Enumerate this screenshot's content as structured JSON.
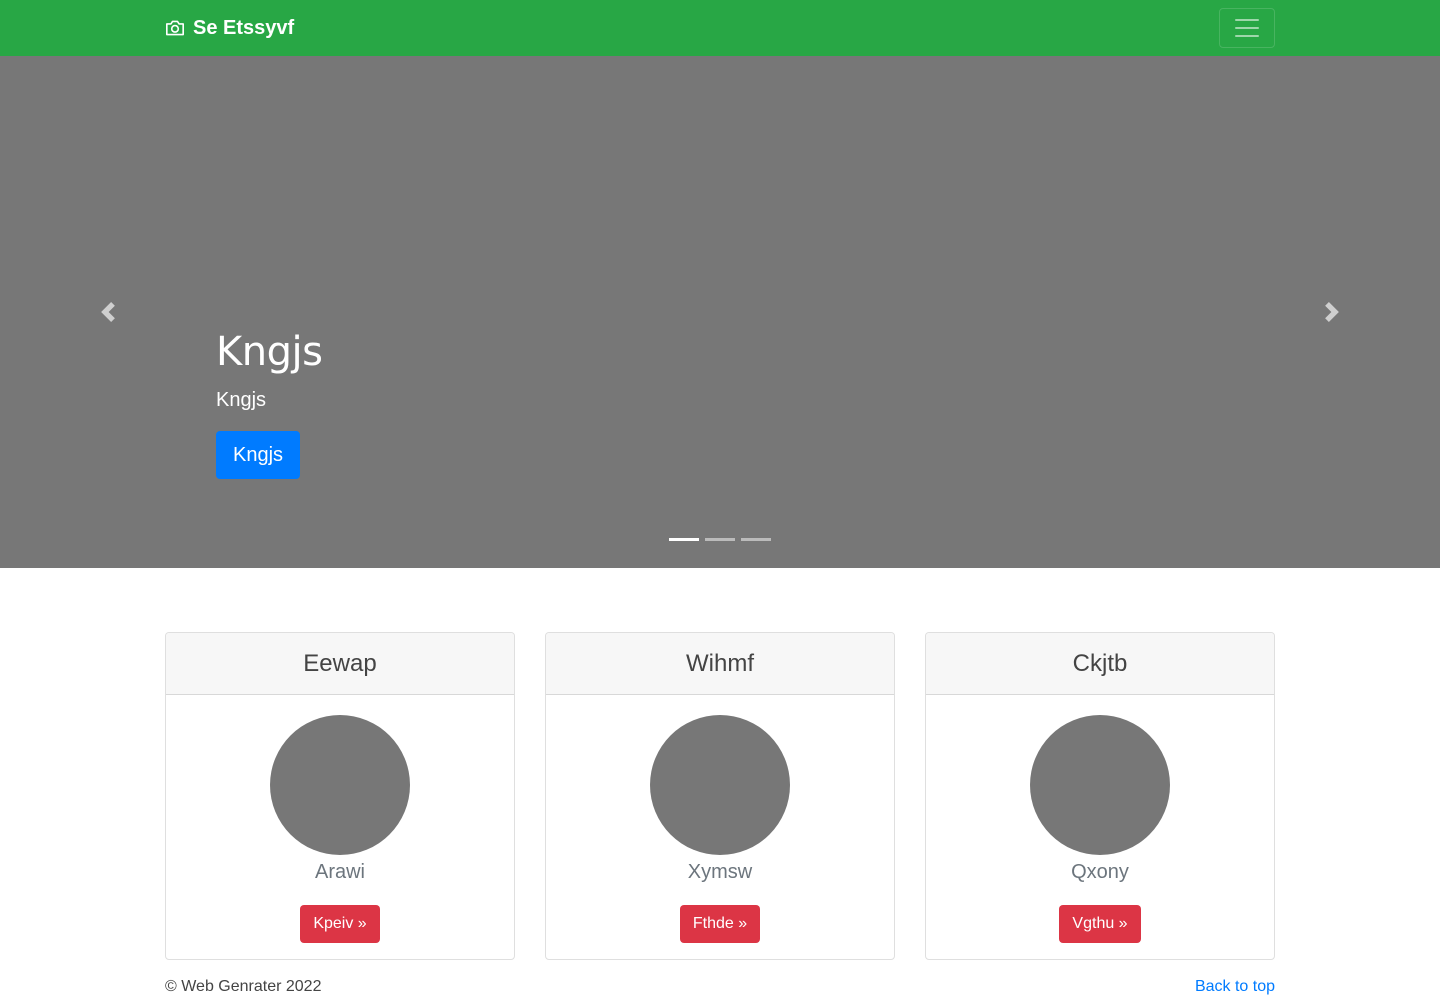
{
  "navbar": {
    "brand": "Se Etssyvf",
    "brand_icon": "camera-icon",
    "toggler_icon": "hamburger-menu-icon",
    "color": "#28a745"
  },
  "carousel": {
    "title": "Kngjs",
    "subtitle": "Kngjs",
    "button_label": "Kngjs",
    "prev_icon": "chevron-left-icon",
    "next_icon": "chevron-right-icon",
    "slide_count": 3,
    "active_slide": 1,
    "background": "#777777"
  },
  "cards": [
    {
      "title": "Eewap",
      "name": "Arawi",
      "button_label": "Kpeiv »"
    },
    {
      "title": "Wihmf",
      "name": "Xymsw",
      "button_label": "Fthde »"
    },
    {
      "title": "Ckjtb",
      "name": "Qxony",
      "button_label": "Vgthu »"
    }
  ],
  "footer": {
    "copyright": "© Web Genrater 2022",
    "back_to_top": "Back to top"
  },
  "colors": {
    "primary": "#007bff",
    "danger": "#dc3545",
    "success": "#28a745"
  }
}
